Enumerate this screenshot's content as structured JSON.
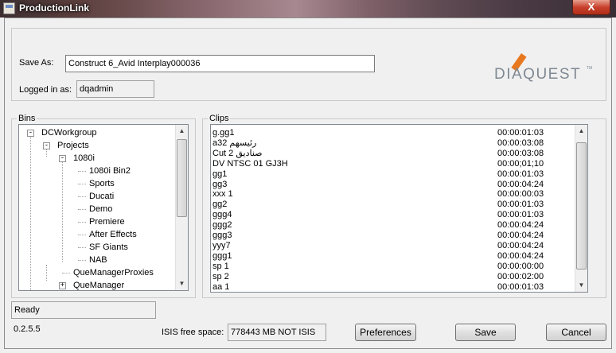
{
  "window": {
    "title": "ProductionLink",
    "close_glyph": "X"
  },
  "save_as": {
    "label": "Save As:",
    "value": "Construct 6_Avid Interplay000036"
  },
  "logged_in": {
    "label": "Logged in as:",
    "value": "dqadmin"
  },
  "logo": {
    "text": "DIAQUEST",
    "tm": "TM",
    "accent_color": "#e8781e",
    "text_color": "#7f8993"
  },
  "bins": {
    "title": "Bins",
    "items": [
      {
        "label": "DCWorkgroup",
        "toggle": "-"
      },
      {
        "label": "Projects",
        "toggle": "-"
      },
      {
        "label": "1080i",
        "toggle": "-"
      },
      {
        "label": "1080i Bin2"
      },
      {
        "label": "Sports"
      },
      {
        "label": "Ducati"
      },
      {
        "label": "Demo"
      },
      {
        "label": "Premiere"
      },
      {
        "label": "After Effects"
      },
      {
        "label": "SF Giants"
      },
      {
        "label": "NAB"
      },
      {
        "label": "QueManagerProxies"
      },
      {
        "label": "QueManager",
        "toggle": "+"
      }
    ]
  },
  "clips": {
    "title": "Clips",
    "rows": [
      {
        "name": "g.gg1",
        "duration": "00:00:01:03"
      },
      {
        "name": "a32 رئيسهم",
        "duration": "00:00:03:08"
      },
      {
        "name": "Cut 2 صناديق",
        "duration": "00:00:03:08"
      },
      {
        "name": "DV NTSC 01 GJ3H",
        "duration": "00:00;01;10"
      },
      {
        "name": "gg1",
        "duration": "00:00:01:03"
      },
      {
        "name": "gg3",
        "duration": "00:00:04:24"
      },
      {
        "name": "xxx 1",
        "duration": "00:00:00:03"
      },
      {
        "name": "gg2",
        "duration": "00:00:01:03"
      },
      {
        "name": "ggg4",
        "duration": "00:00:01:03"
      },
      {
        "name": "ggg2",
        "duration": "00:00:04:24"
      },
      {
        "name": "ggg3",
        "duration": "00:00:04:24"
      },
      {
        "name": "yyy7",
        "duration": "00:00:04:24"
      },
      {
        "name": "ggg1",
        "duration": "00:00:04:24"
      },
      {
        "name": "sp 1",
        "duration": "00:00:00:00"
      },
      {
        "name": "sp 2",
        "duration": "00:00:02:00"
      },
      {
        "name": "aa 1",
        "duration": "00:00:01:03"
      }
    ]
  },
  "status": {
    "text": "Ready"
  },
  "version": "0.2.5.5",
  "isis": {
    "label": "ISIS free space:",
    "value": "778443 MB NOT ISIS"
  },
  "buttons": {
    "preferences": "Preferences",
    "save": "Save",
    "cancel": "Cancel"
  },
  "scroll_glyphs": {
    "up": "▲",
    "down": "▼"
  }
}
